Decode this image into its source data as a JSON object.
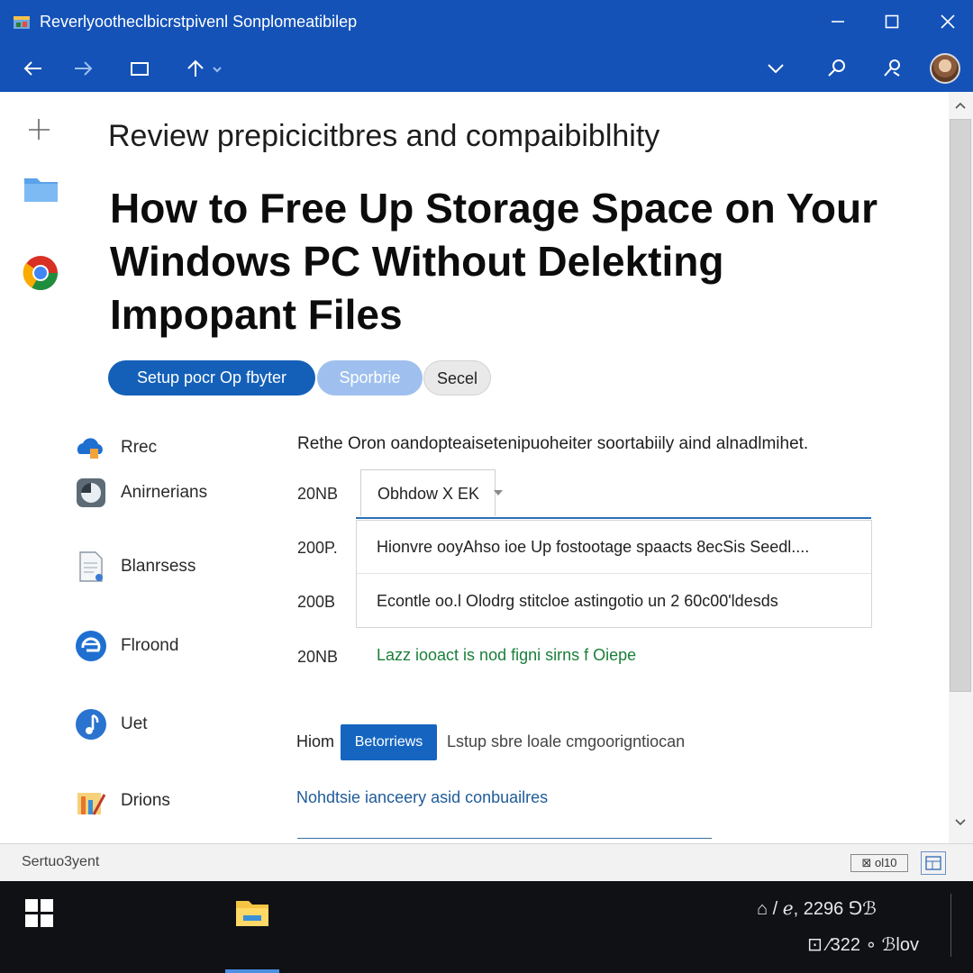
{
  "window": {
    "title": "Reverlyootheclbicrstpivenl Sonplomeatibilep"
  },
  "toolbar": {
    "back": "back-arrow",
    "forward": "forward-arrow",
    "tabs": "tab-view",
    "up": "up-arrow-dropdown",
    "right_icons": [
      "chevron-down",
      "search",
      "account"
    ]
  },
  "sidebar_rail": {
    "icons": [
      "plus-icon",
      "folder-icon",
      "browser-icon"
    ]
  },
  "content": {
    "subtitle": "Review prepicicitbres and compaibiblhity",
    "title": "How to Free Up Storage Space on Your Windows PC Without Delekting Impopant Files",
    "buttons": {
      "primary": "Setup pocr Op fbyter",
      "secondary": "Sporbrie",
      "tertiary": "Secel"
    },
    "nav_items": [
      {
        "label": "Rrec",
        "icon": "cloud-icon"
      },
      {
        "label": "Anirnerians",
        "icon": "disk-icon"
      },
      {
        "label": "Blanrsess",
        "icon": "document-icon"
      },
      {
        "label": "Flroond",
        "icon": "browser-icon"
      },
      {
        "label": "Uet",
        "icon": "music-icon"
      },
      {
        "label": "Drions",
        "icon": "tools-icon"
      }
    ],
    "intro": "Rethe Oron oandopteaisetenipuoheiter soortabiily aind alnadlmihet.",
    "size_labels": [
      "20NB",
      "200P.",
      "200B",
      "20NB"
    ],
    "dropdown_value": "Obhdow X EK",
    "results": [
      "Hionvre ooyAhso ioe Up fostootage spaacts 8ecSis Seedl....",
      "Econtle oo.l Olodrg stitcloe astingotio un 2 60c00'ldesds"
    ],
    "green_link": "Lazz iooact is nod figni sirns f Oiepe",
    "bottom_label": "Hiom",
    "action_button": "Betorriews",
    "setup_text": "Lstup sbre loale cmgoorigntiocan",
    "blue_link": "Nohdtsie ianceery asid conbuailres"
  },
  "statusbar": {
    "text": "Sertuo3yent",
    "zoom": "⊠ ol10",
    "view_icon": "layout-icon"
  },
  "taskbar": {
    "apps": [
      "start-icon",
      "file-explorer-icon"
    ],
    "tray_line1": "⌂ / ℯ, 2296 ⅁ℬ",
    "tray_line2": "⊡ ∕322 ∘ ℬlov"
  },
  "colors": {
    "accent": "#1452b8",
    "primary_button": "#1460b8",
    "secondary_button": "#9fc0ee",
    "link_green": "#1a7f3a",
    "link_blue": "#1f5c99"
  }
}
